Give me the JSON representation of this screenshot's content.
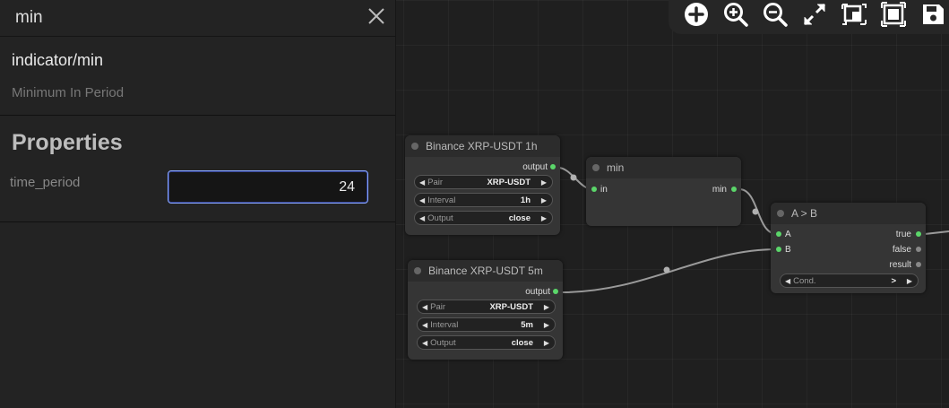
{
  "panel": {
    "title": "min",
    "node_type": "indicator/min",
    "description": "Minimum In Period",
    "properties_heading": "Properties",
    "property": {
      "label": "time_period",
      "value": "24"
    }
  },
  "toolbar": {
    "icons": [
      "add-icon",
      "zoom-in-icon",
      "zoom-out-icon",
      "fullscreen-icon",
      "fit-selection-icon",
      "fit-all-icon",
      "save-icon"
    ]
  },
  "nodes": {
    "binance1h": {
      "title": "Binance XRP-USDT 1h",
      "output": "output",
      "widgets": [
        {
          "label": "Pair",
          "value": "XRP-USDT"
        },
        {
          "label": "Interval",
          "value": "1h"
        },
        {
          "label": "Output",
          "value": "close"
        }
      ]
    },
    "min": {
      "title": "min",
      "input": "in",
      "output": "min"
    },
    "compare": {
      "title": "A > B",
      "inputs": [
        "A",
        "B"
      ],
      "outputs": [
        "true",
        "false",
        "result"
      ],
      "widget": {
        "label": "Cond.",
        "value": ">"
      }
    },
    "binance5m": {
      "title": "Binance XRP-USDT 5m",
      "output": "output",
      "widgets": [
        {
          "label": "Pair",
          "value": "XRP-USDT"
        },
        {
          "label": "Interval",
          "value": "5m"
        },
        {
          "label": "Output",
          "value": "close"
        }
      ]
    }
  }
}
